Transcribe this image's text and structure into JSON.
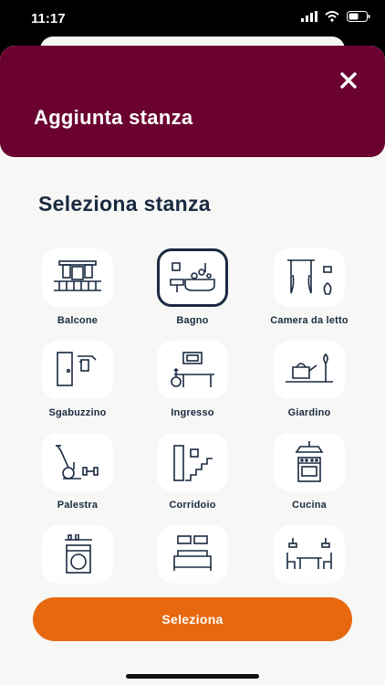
{
  "status_bar": {
    "time": "11:17"
  },
  "header": {
    "title": "Aggiunta stanza"
  },
  "section_title": "Seleziona stanza",
  "rooms": [
    {
      "label": "Balcone",
      "icon": "balcony-icon",
      "selected": false
    },
    {
      "label": "Bagno",
      "icon": "bathroom-icon",
      "selected": true
    },
    {
      "label": "Camera da letto",
      "icon": "bedroom-icon",
      "selected": false
    },
    {
      "label": "Sgabuzzino",
      "icon": "storage-closet-icon",
      "selected": false
    },
    {
      "label": "Ingresso",
      "icon": "entrance-icon",
      "selected": false
    },
    {
      "label": "Giardino",
      "icon": "garden-icon",
      "selected": false
    },
    {
      "label": "Palestra",
      "icon": "gym-icon",
      "selected": false
    },
    {
      "label": "Corridoio",
      "icon": "hallway-icon",
      "selected": false
    },
    {
      "label": "Cucina",
      "icon": "kitchen-icon",
      "selected": false
    },
    {
      "label": "",
      "icon": "laundry-icon",
      "selected": false
    },
    {
      "label": "",
      "icon": "living-room-icon",
      "selected": false
    },
    {
      "label": "",
      "icon": "dining-room-icon",
      "selected": false
    }
  ],
  "primary_button": {
    "label": "Seleziona"
  },
  "colors": {
    "header": "#6b0130",
    "accent": "#e8680f",
    "text": "#1a2a40",
    "background": "#f7f7f5"
  }
}
